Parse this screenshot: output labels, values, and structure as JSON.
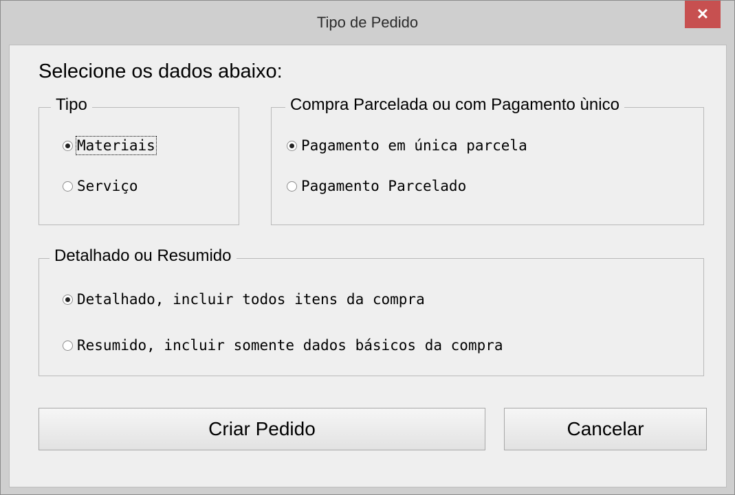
{
  "window": {
    "title": "Tipo de Pedido",
    "close_glyph": "✕"
  },
  "heading": "Selecione os dados abaixo:",
  "tipo": {
    "legend": "Tipo",
    "options": [
      {
        "label": "Materiais",
        "checked": true
      },
      {
        "label": "Serviço",
        "checked": false
      }
    ]
  },
  "compra": {
    "legend": "Compra Parcelada ou com Pagamento ùnico",
    "options": [
      {
        "label": "Pagamento em única parcela",
        "checked": true
      },
      {
        "label": "Pagamento Parcelado",
        "checked": false
      }
    ]
  },
  "detalhe": {
    "legend": "Detalhado ou Resumido",
    "options": [
      {
        "label": "Detalhado, incluir todos itens da compra",
        "checked": true
      },
      {
        "label": "Resumido, incluir somente dados básicos da compra",
        "checked": false
      }
    ]
  },
  "buttons": {
    "criar": "Criar Pedido",
    "cancelar": "Cancelar"
  },
  "colors": {
    "close_button": "#c75050",
    "window_frame": "#cfcfcf",
    "dialog_bg": "#efefef"
  }
}
